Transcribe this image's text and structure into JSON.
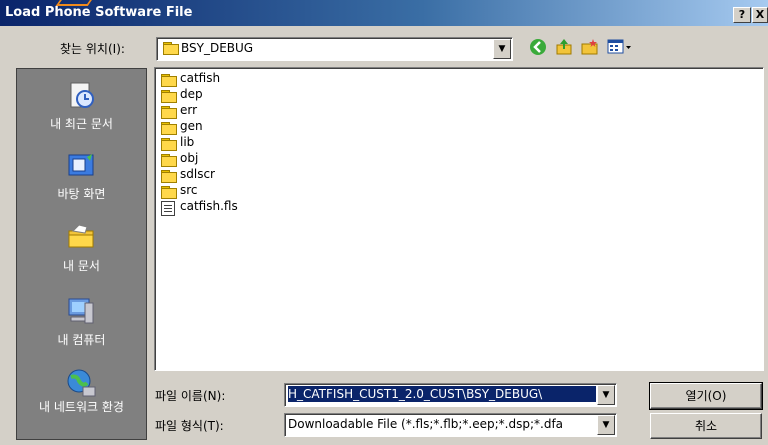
{
  "window": {
    "title": "Load Phone Software File",
    "help_label": "?",
    "close_label": "X"
  },
  "look_in": {
    "label": "찾는 위치(I):",
    "value": "BSY_DEBUG",
    "arrow": "▼"
  },
  "toolbar": {
    "back_icon": "back-icon",
    "up_icon": "up-folder-icon",
    "new_folder_icon": "new-folder-icon",
    "view_menu_icon": "view-menu-icon"
  },
  "places": [
    {
      "label": "내 최근 문서",
      "icon": "recent-documents-icon"
    },
    {
      "label": "바탕 화면",
      "icon": "desktop-icon"
    },
    {
      "label": "내 문서",
      "icon": "my-documents-icon"
    },
    {
      "label": "내 컴퓨터",
      "icon": "my-computer-icon"
    },
    {
      "label": "내 네트워크 환경",
      "icon": "network-places-icon"
    }
  ],
  "files": [
    {
      "name": "catfish",
      "type": "folder"
    },
    {
      "name": "dep",
      "type": "folder"
    },
    {
      "name": "err",
      "type": "folder"
    },
    {
      "name": "gen",
      "type": "folder"
    },
    {
      "name": "lib",
      "type": "folder"
    },
    {
      "name": "obj",
      "type": "folder"
    },
    {
      "name": "sdlscr",
      "type": "folder"
    },
    {
      "name": "src",
      "type": "folder"
    },
    {
      "name": "catfish.fls",
      "type": "file"
    }
  ],
  "file_name": {
    "label": "파일 이름(N):",
    "value": "H_CATFISH_CUST1_2.0_CUST\\BSY_DEBUG\\"
  },
  "file_type": {
    "label": "파일 형식(T):",
    "value": "Downloadable File (*.fls;*.flb;*.eep;*.dsp;*.dfa"
  },
  "buttons": {
    "open": "열기(O)",
    "cancel": "취소"
  }
}
